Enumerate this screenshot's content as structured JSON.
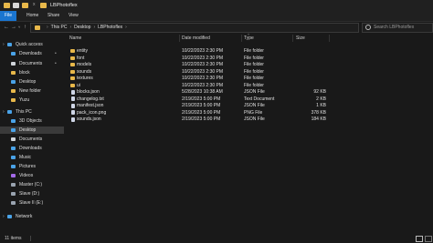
{
  "window": {
    "title": "LBPhotoflex",
    "close_glyph": "x"
  },
  "ribbon": {
    "tabs": [
      "File",
      "Home",
      "Share",
      "View"
    ]
  },
  "address": {
    "breadcrumb": [
      "This PC",
      "Desktop",
      "LBPhotoflex"
    ],
    "search_placeholder": "Search LBPhotoflex"
  },
  "nav_pane": {
    "items": [
      {
        "label": "Quick access",
        "icon": "star-icon",
        "color": "#4aa3e8",
        "indent": 0,
        "pinned": false
      },
      {
        "label": "Downloads",
        "icon": "download-icon",
        "color": "#4aa3e8",
        "indent": 1,
        "pinned": true
      },
      {
        "label": "Documents",
        "icon": "document-icon",
        "color": "#d0d4da",
        "indent": 1,
        "pinned": true
      },
      {
        "label": "block",
        "icon": "folder-icon",
        "color": "#e8b84a",
        "indent": 1,
        "pinned": false
      },
      {
        "label": "Desktop",
        "icon": "desktop-icon",
        "color": "#4aa3e8",
        "indent": 1,
        "pinned": false
      },
      {
        "label": "New folder",
        "icon": "folder-icon",
        "color": "#e8b84a",
        "indent": 1,
        "pinned": false
      },
      {
        "label": "Yuzu",
        "icon": "folder-icon",
        "color": "#e8b84a",
        "indent": 1,
        "pinned": false
      },
      {
        "label": "This PC",
        "icon": "pc-icon",
        "color": "#4aa3e8",
        "indent": 0,
        "pinned": false
      },
      {
        "label": "3D Objects",
        "icon": "cube-icon",
        "color": "#4aa3e8",
        "indent": 1,
        "pinned": false
      },
      {
        "label": "Desktop",
        "icon": "desktop-icon",
        "color": "#4aa3e8",
        "indent": 1,
        "pinned": false,
        "selected": true
      },
      {
        "label": "Documents",
        "icon": "document-icon",
        "color": "#d0d4da",
        "indent": 1,
        "pinned": false
      },
      {
        "label": "Downloads",
        "icon": "download-icon",
        "color": "#4aa3e8",
        "indent": 1,
        "pinned": false
      },
      {
        "label": "Music",
        "icon": "music-icon",
        "color": "#4aa3e8",
        "indent": 1,
        "pinned": false
      },
      {
        "label": "Pictures",
        "icon": "picture-icon",
        "color": "#4aa3e8",
        "indent": 1,
        "pinned": false
      },
      {
        "label": "Videos",
        "icon": "video-icon",
        "color": "#a36ae8",
        "indent": 1,
        "pinned": false
      },
      {
        "label": "Master (C:)",
        "icon": "drive-icon",
        "color": "#9aa4b0",
        "indent": 1,
        "pinned": false
      },
      {
        "label": "Slave (D:)",
        "icon": "drive-icon",
        "color": "#9aa4b0",
        "indent": 1,
        "pinned": false
      },
      {
        "label": "Slave II (E:)",
        "icon": "drive-icon",
        "color": "#9aa4b0",
        "indent": 1,
        "pinned": false
      },
      {
        "label": "Network",
        "icon": "network-icon",
        "color": "#4aa3e8",
        "indent": 0,
        "pinned": false
      }
    ]
  },
  "columns": {
    "name": "Name",
    "date": "Date modified",
    "type": "Type",
    "size": "Size"
  },
  "files": [
    {
      "name": "entity",
      "date": "10/22/2023 2:30 PM",
      "type": "File folder",
      "size": "",
      "kind": "folder"
    },
    {
      "name": "font",
      "date": "10/22/2023 2:30 PM",
      "type": "File folder",
      "size": "",
      "kind": "folder"
    },
    {
      "name": "models",
      "date": "10/22/2023 2:30 PM",
      "type": "File folder",
      "size": "",
      "kind": "folder"
    },
    {
      "name": "sounds",
      "date": "10/22/2023 2:30 PM",
      "type": "File folder",
      "size": "",
      "kind": "folder"
    },
    {
      "name": "textures",
      "date": "10/22/2023 2:30 PM",
      "type": "File folder",
      "size": "",
      "kind": "folder"
    },
    {
      "name": "ui",
      "date": "10/22/2023 2:30 PM",
      "type": "File folder",
      "size": "",
      "kind": "folder"
    },
    {
      "name": "blocks.json",
      "date": "5/28/2023 10:38 AM",
      "type": "JSON File",
      "size": "92 KB",
      "kind": "file"
    },
    {
      "name": "changelog.txt",
      "date": "2/19/2023 5:00 PM",
      "type": "Text Document",
      "size": "2 KB",
      "kind": "file"
    },
    {
      "name": "manifest.json",
      "date": "2/19/2023 5:00 PM",
      "type": "JSON File",
      "size": "1 KB",
      "kind": "file"
    },
    {
      "name": "pack_icon.png",
      "date": "2/19/2023 5:00 PM",
      "type": "PNG File",
      "size": "378 KB",
      "kind": "file"
    },
    {
      "name": "sounds.json",
      "date": "2/19/2023 5:00 PM",
      "type": "JSON File",
      "size": "184 KB",
      "kind": "file"
    }
  ],
  "status": {
    "item_count": "11 items"
  }
}
